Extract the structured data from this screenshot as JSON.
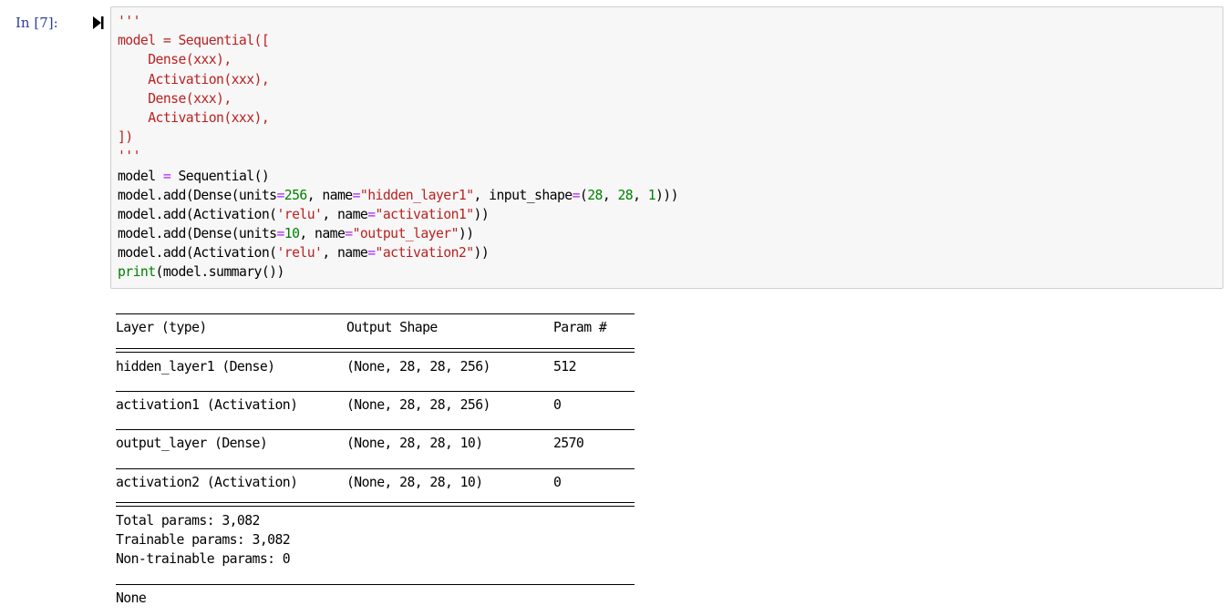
{
  "cell": {
    "prompt": "In [7]:",
    "run_icon": "run-cell-icon",
    "code_lines": [
      [
        {
          "t": "'''",
          "c": "str"
        }
      ],
      [
        {
          "t": "model = Sequential([",
          "c": "str"
        }
      ],
      [
        {
          "t": "    Dense(xxx),",
          "c": "str"
        }
      ],
      [
        {
          "t": "    Activation(xxx),",
          "c": "str"
        }
      ],
      [
        {
          "t": "    Dense(xxx),",
          "c": "str"
        }
      ],
      [
        {
          "t": "    Activation(xxx),",
          "c": "str"
        }
      ],
      [
        {
          "t": "])",
          "c": "str"
        }
      ],
      [
        {
          "t": "'''",
          "c": "str"
        }
      ],
      [
        {
          "t": "model ",
          "c": ""
        },
        {
          "t": "=",
          "c": "op"
        },
        {
          "t": " Sequential()",
          "c": ""
        }
      ],
      [
        {
          "t": "model.add(Dense(units",
          "c": ""
        },
        {
          "t": "=",
          "c": "op"
        },
        {
          "t": "256",
          "c": "num"
        },
        {
          "t": ", name",
          "c": ""
        },
        {
          "t": "=",
          "c": "op"
        },
        {
          "t": "\"hidden_layer1\"",
          "c": "str"
        },
        {
          "t": ", input_shape",
          "c": ""
        },
        {
          "t": "=",
          "c": "op"
        },
        {
          "t": "(",
          "c": ""
        },
        {
          "t": "28",
          "c": "num"
        },
        {
          "t": ", ",
          "c": ""
        },
        {
          "t": "28",
          "c": "num"
        },
        {
          "t": ", ",
          "c": ""
        },
        {
          "t": "1",
          "c": "num"
        },
        {
          "t": ")))",
          "c": ""
        }
      ],
      [
        {
          "t": "model.add(Activation(",
          "c": ""
        },
        {
          "t": "'relu'",
          "c": "str"
        },
        {
          "t": ", name",
          "c": ""
        },
        {
          "t": "=",
          "c": "op"
        },
        {
          "t": "\"activation1\"",
          "c": "str"
        },
        {
          "t": "))",
          "c": ""
        }
      ],
      [
        {
          "t": "model.add(Dense(units",
          "c": ""
        },
        {
          "t": "=",
          "c": "op"
        },
        {
          "t": "10",
          "c": "num"
        },
        {
          "t": ", name",
          "c": ""
        },
        {
          "t": "=",
          "c": "op"
        },
        {
          "t": "\"output_layer\"",
          "c": "str"
        },
        {
          "t": "))",
          "c": ""
        }
      ],
      [
        {
          "t": "model.add(Activation(",
          "c": ""
        },
        {
          "t": "'relu'",
          "c": "str"
        },
        {
          "t": ", name",
          "c": ""
        },
        {
          "t": "=",
          "c": "op"
        },
        {
          "t": "\"activation2\"",
          "c": "str"
        },
        {
          "t": "))",
          "c": ""
        }
      ],
      [
        {
          "t": "print",
          "c": "kw"
        },
        {
          "t": "(model.summary())",
          "c": ""
        }
      ]
    ]
  },
  "summary": {
    "header": {
      "layer": "Layer (type)",
      "shape": "Output Shape",
      "params": "Param #"
    },
    "rows": [
      {
        "layer": "hidden_layer1 (Dense)",
        "shape": "(None, 28, 28, 256)",
        "params": "512"
      },
      {
        "layer": "activation1 (Activation)",
        "shape": "(None, 28, 28, 256)",
        "params": "0"
      },
      {
        "layer": "output_layer (Dense)",
        "shape": "(None, 28, 28, 10)",
        "params": "2570"
      },
      {
        "layer": "activation2 (Activation)",
        "shape": "(None, 28, 28, 10)",
        "params": "0"
      }
    ],
    "total": "Total params: 3,082",
    "trainable": "Trainable params: 3,082",
    "non_trainable": "Non-trainable params: 0",
    "result": "None"
  },
  "colors": {
    "prompt": "#303f9f",
    "string": "#ba2121",
    "operator": "#aa22ff",
    "number": "#008000",
    "builtin": "#008000",
    "cell_bg": "#f7f7f7",
    "cell_border": "#cfcfcf"
  }
}
